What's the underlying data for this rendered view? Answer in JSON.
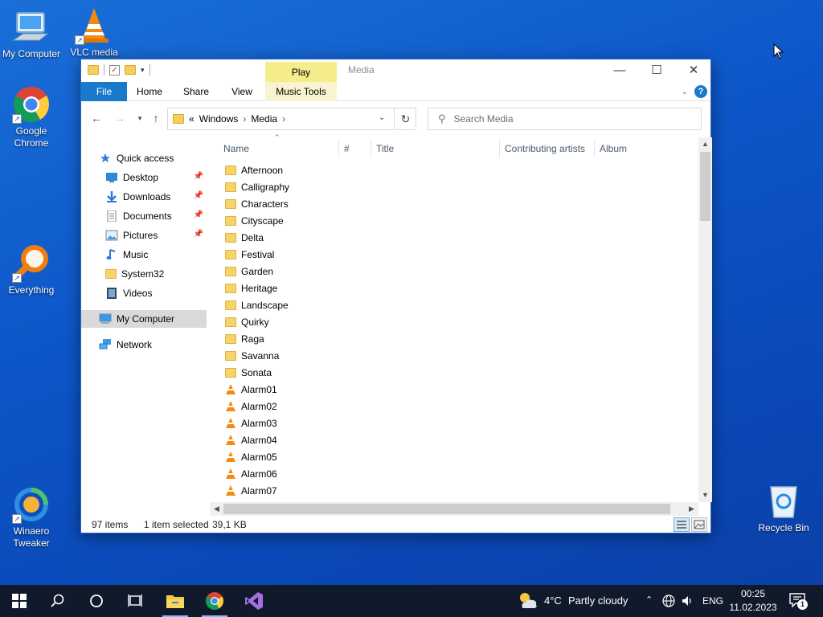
{
  "desktop": {
    "icons": [
      {
        "label": "My Computer"
      },
      {
        "label": "VLC media"
      },
      {
        "label": "Google Chrome"
      },
      {
        "label": "Everything"
      },
      {
        "label": "Winaero Tweaker"
      },
      {
        "label": "Recycle Bin"
      }
    ]
  },
  "window": {
    "title": "Media",
    "context_tab": "Play",
    "ribbon_tabs": [
      "File",
      "Home",
      "Share",
      "View",
      "Music Tools"
    ],
    "address": {
      "prefix": "«",
      "crumbs": [
        "Windows",
        "Media"
      ]
    },
    "search": {
      "placeholder": "Search Media"
    },
    "nav_items": [
      {
        "label": "Quick access",
        "icon": "star-icon"
      },
      {
        "label": "Desktop",
        "icon": "desktop-icon",
        "pinned": true
      },
      {
        "label": "Downloads",
        "icon": "download-icon",
        "pinned": true
      },
      {
        "label": "Documents",
        "icon": "document-icon",
        "pinned": true
      },
      {
        "label": "Pictures",
        "icon": "pictures-icon",
        "pinned": true
      },
      {
        "label": "Music",
        "icon": "music-icon"
      },
      {
        "label": "System32",
        "icon": "folder-icon"
      },
      {
        "label": "Videos",
        "icon": "videos-icon"
      },
      {
        "label": "My Computer",
        "icon": "computer-icon",
        "selected": true
      },
      {
        "label": "Network",
        "icon": "network-icon"
      }
    ],
    "columns": [
      "Name",
      "#",
      "Title",
      "Contributing artists",
      "Album"
    ],
    "files": [
      {
        "name": "Afternoon",
        "type": "folder"
      },
      {
        "name": "Calligraphy",
        "type": "folder"
      },
      {
        "name": "Characters",
        "type": "folder"
      },
      {
        "name": "Cityscape",
        "type": "folder"
      },
      {
        "name": "Delta",
        "type": "folder"
      },
      {
        "name": "Festival",
        "type": "folder"
      },
      {
        "name": "Garden",
        "type": "folder"
      },
      {
        "name": "Heritage",
        "type": "folder"
      },
      {
        "name": "Landscape",
        "type": "folder"
      },
      {
        "name": "Quirky",
        "type": "folder"
      },
      {
        "name": "Raga",
        "type": "folder"
      },
      {
        "name": "Savanna",
        "type": "folder"
      },
      {
        "name": "Sonata",
        "type": "folder"
      },
      {
        "name": "Alarm01",
        "type": "audio"
      },
      {
        "name": "Alarm02",
        "type": "audio"
      },
      {
        "name": "Alarm03",
        "type": "audio"
      },
      {
        "name": "Alarm04",
        "type": "audio"
      },
      {
        "name": "Alarm05",
        "type": "audio"
      },
      {
        "name": "Alarm06",
        "type": "audio"
      },
      {
        "name": "Alarm07",
        "type": "audio"
      }
    ],
    "status": {
      "count": "97 items",
      "selected": "1 item selected",
      "size": "39,1 KB"
    }
  },
  "taskbar": {
    "weather_temp": "4°C",
    "weather_text": "Partly cloudy",
    "language": "ENG",
    "time": "00:25",
    "date": "11.02.2023",
    "notification_count": "1"
  },
  "colors": {
    "accent": "#1979ca",
    "context_tab": "#f5ec8c",
    "taskbar": "#101a2b"
  }
}
